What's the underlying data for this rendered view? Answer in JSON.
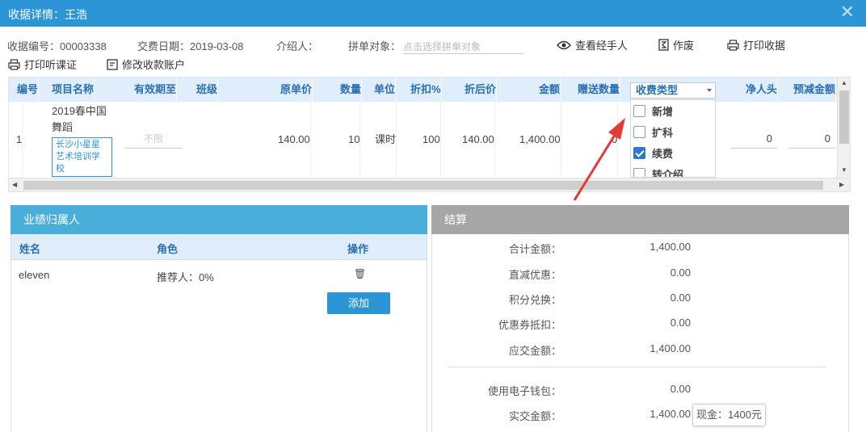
{
  "window": {
    "title": "收据详情：王浩",
    "close_icon": "close-icon"
  },
  "info": {
    "receipt_no": "收据编号：00003338",
    "pay_date": "交费日期：2019-03-08",
    "introducer": "介绍人：",
    "group_target_label": "拼单对象：",
    "group_target_placeholder": "点击选择拼单对象"
  },
  "actions": {
    "view_handler": "查看经手人",
    "void": "作废",
    "print_receipt": "打印收据",
    "print_trial": "打印听课证",
    "modify_account": "修改收款账户"
  },
  "grid": {
    "headers": {
      "no": "编号",
      "item": "项目名称",
      "valid_until": "有效期至",
      "class": "班级",
      "orig_price": "原单价",
      "qty": "数量",
      "unit": "单位",
      "discount": "折扣%",
      "after_price": "折后价",
      "amount": "金额",
      "gift_qty": "赠送数量",
      "net_head": "净人头",
      "pre_deduct": "预减金额"
    },
    "row": {
      "no": "1",
      "item_name": "2019春中国舞蹈",
      "school": "长沙小星星艺术培训学校",
      "valid_until": "不限",
      "orig_price": "140.00",
      "qty": "10",
      "unit": "课时",
      "discount": "100",
      "after_price": "140.00",
      "amount": "1,400.00",
      "gift_qty": "0",
      "net_head": "0",
      "pre_deduct": "0"
    },
    "fee_type": {
      "label": "收费类型",
      "options": [
        {
          "label": "新增",
          "checked": false
        },
        {
          "label": "扩科",
          "checked": false
        },
        {
          "label": "续费",
          "checked": true
        },
        {
          "label": "转介绍",
          "checked": false
        }
      ]
    }
  },
  "performance": {
    "title": "业绩归属人",
    "columns": {
      "name": "姓名",
      "role": "角色",
      "op": "操作"
    },
    "rows": [
      {
        "name": "eleven",
        "role": "推荐人：0%"
      }
    ],
    "add_label": "添加"
  },
  "settlement": {
    "title": "结算",
    "items": [
      {
        "label": "合计金额：",
        "value": "1,400.00"
      },
      {
        "label": "直减优惠：",
        "value": "0.00"
      },
      {
        "label": "积分兑换：",
        "value": "0.00"
      },
      {
        "label": "优惠券抵扣：",
        "value": "0.00"
      },
      {
        "label": "应交金额：",
        "value": "1,400.00"
      },
      {
        "label": "使用电子钱包：",
        "value": "0.00"
      },
      {
        "label": "实交金额：",
        "value": "1,400.00"
      }
    ],
    "tooltip": "现金：1400元"
  },
  "colors": {
    "primary": "#2b95d6",
    "header_bg": "#dfeefa",
    "settle_head": "#a6a6a6",
    "perf_head": "#4aaedb",
    "annotation": "#e53935"
  }
}
